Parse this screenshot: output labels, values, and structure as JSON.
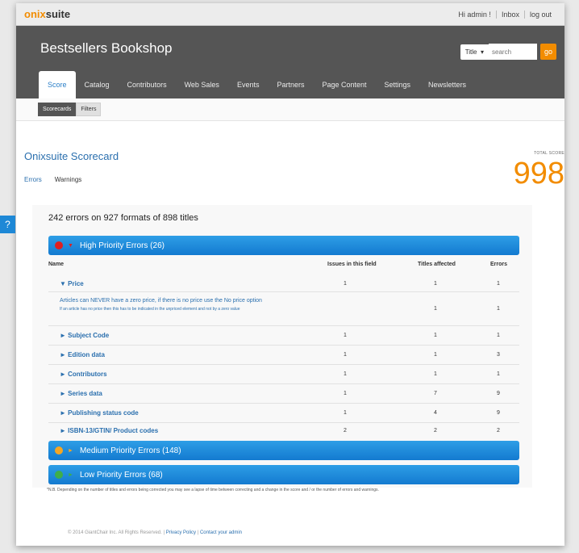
{
  "topbar": {
    "logo_part1": "onix",
    "logo_part2": "suite",
    "greeting": "Hi admin !",
    "inbox": "Inbox",
    "logout": "log out"
  },
  "header": {
    "shop_title": "Bestsellers Bookshop",
    "search_select": "Title",
    "search_placeholder": "search",
    "go_label": "go"
  },
  "nav": {
    "tabs": [
      "Score",
      "Catalog",
      "Contributors",
      "Web Sales",
      "Events",
      "Partners",
      "Page Content",
      "Settings",
      "Newsletters"
    ],
    "active": "Score"
  },
  "subnav": {
    "scorecards": "Scorecards",
    "filters": "Filters"
  },
  "scorecard": {
    "title": "Onixsuite Scorecard",
    "errors_link": "Errors",
    "warnings_link": "Warnings",
    "total_label": "TOTAL SCORE",
    "total_score": "998",
    "help": "?"
  },
  "summary": "242 errors on 927 formats of 898 titles",
  "priorities": {
    "high": {
      "label": "High Priority Errors (26)",
      "color": "#e01f1f"
    },
    "medium": {
      "label": "Medium Priority Errors (148)",
      "color": "#f5a623"
    },
    "low": {
      "label": "Low Priority Errors (68)",
      "color": "#3fae49"
    }
  },
  "table": {
    "headers": {
      "name": "Name",
      "issues": "Issues in this field",
      "titles": "Titles affected",
      "errors": "Errors"
    },
    "price": {
      "name": "▼ Price",
      "issues": "1",
      "titles": "1",
      "errors": "1"
    },
    "description": {
      "main": "Articles can NEVER have a zero price, if there is no price use the No price option",
      "sub": "If an article has no price then this has to be indicated in the unpriced element and not by a zero value",
      "titles": "1",
      "errors": "1"
    },
    "rows": [
      {
        "name": "► Subject Code",
        "issues": "1",
        "titles": "1",
        "errors": "1"
      },
      {
        "name": "► Edition data",
        "issues": "1",
        "titles": "1",
        "errors": "3"
      },
      {
        "name": "► Contributors",
        "issues": "1",
        "titles": "1",
        "errors": "1"
      },
      {
        "name": "► Series data",
        "issues": "1",
        "titles": "7",
        "errors": "9"
      },
      {
        "name": "► Publishing status code",
        "issues": "1",
        "titles": "4",
        "errors": "9"
      },
      {
        "name": "► ISBN-13/GTIN/ Product codes",
        "issues": "2",
        "titles": "2",
        "errors": "2"
      }
    ]
  },
  "footnote": "*N.B. Depending on the number of titles and errors being corrected you may see a lapse of time between correcting and a change in the score and / or the number of errors and warnings.",
  "footer": {
    "copyright": "© 2014 GiantChair Inc. All Rights Reserved. |",
    "privacy": "Privacy Policy",
    "sep": "|",
    "contact": "Contact your admin"
  }
}
